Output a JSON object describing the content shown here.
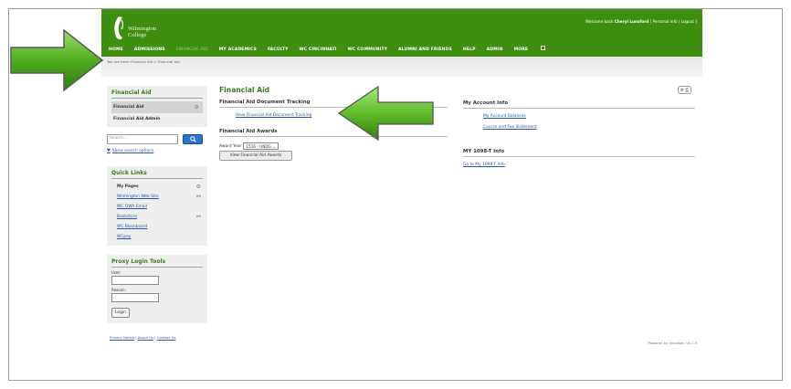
{
  "header": {
    "logo_line1": "Wilmington",
    "logo_line2": "College",
    "welcome_prefix": "Welcome back",
    "welcome_name": "Cheryl Lunsford",
    "welcome_links": "[ Personal Info | Logout ]"
  },
  "nav": {
    "items": [
      {
        "label": "HOME",
        "active": false
      },
      {
        "label": "ADMISSIONS",
        "active": false
      },
      {
        "label": "FINANCIAL AID",
        "active": true
      },
      {
        "label": "MY ACADEMICS",
        "active": false
      },
      {
        "label": "FACULTY",
        "active": false
      },
      {
        "label": "WC CINCINNATI",
        "active": false
      },
      {
        "label": "WC COMMUNITY",
        "active": false
      },
      {
        "label": "ALUMNI AND FRIENDS",
        "active": false
      },
      {
        "label": "HELP",
        "active": false
      },
      {
        "label": "ADMIN",
        "active": false
      },
      {
        "label": "MORE",
        "active": false
      }
    ],
    "more_icon": "dropdown-box-icon"
  },
  "breadcrumb": "You are here: Financial Aid > Financial Aid",
  "sidebar": {
    "fa_title": "Financial Aid",
    "fa_items": [
      {
        "label": "Financial Aid",
        "selected": true
      },
      {
        "label": "Financial Aid Admin",
        "selected": false
      }
    ],
    "search_placeholder": "Search...",
    "show_search_options": "Show search options",
    "quick_links_title": "Quick Links",
    "quick_links": [
      {
        "label": "My Pages",
        "bold": true,
        "icon": "gear-icon"
      },
      {
        "label": "Wilmington Web Site",
        "bold": false,
        "icon": "link-icon"
      },
      {
        "label": "WC OWA Email",
        "bold": false,
        "icon": ""
      },
      {
        "label": "Bookstore",
        "bold": false,
        "icon": "link-icon"
      },
      {
        "label": "WC Blackboard",
        "bold": false,
        "icon": ""
      },
      {
        "label": "WCpay",
        "bold": false,
        "icon": ""
      }
    ],
    "proxy_title": "Proxy Login Tools",
    "user_label": "User:",
    "reason_label": "Reason:",
    "login_label": "Login"
  },
  "main": {
    "page_title": "Financial Aid",
    "doc_tracking_title": "Financial Aid Document Tracking",
    "doc_tracking_link": "View Financial Aid Document Tracking",
    "awards_title": "Financial Aid Awards",
    "award_year_label": "Award Year",
    "award_year_value": "1516 - UNDG",
    "view_awards_button": "View Financial Aid Awards"
  },
  "right": {
    "account_title": "My Account Info",
    "account_links": [
      "My Account Balances",
      "Course and Fee Statement"
    ],
    "t1098_title": "MY 1098-T Info",
    "t1098_link": "Go to My 1098-T Info"
  },
  "footer": {
    "links": [
      "Privacy Notice",
      "About Us",
      "Contact Us"
    ],
    "powered": "Powered by Jenzabar. v6.1.0"
  },
  "colors": {
    "brand_green": "#3e8f0f",
    "arrow_green": "#5bb82a",
    "link_blue": "#2a58a8"
  }
}
